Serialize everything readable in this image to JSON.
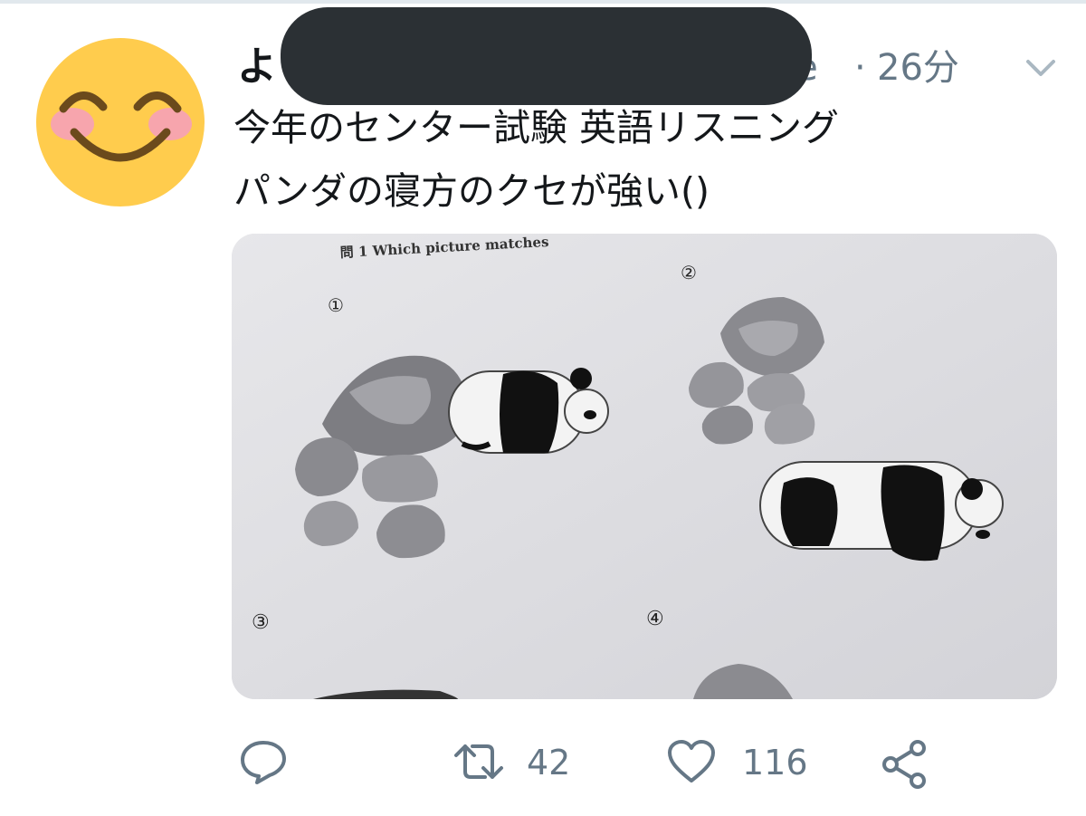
{
  "tweet": {
    "author_initial": "よ",
    "handle_tail": "le",
    "separator": "·",
    "time": "26分",
    "text": "今年のセンター試験 英語リスニング\nパンダの寝方のクセが強い()"
  },
  "media": {
    "header_text": "問 1  Which picture matches",
    "option_labels": [
      "①",
      "②",
      "③",
      "④"
    ]
  },
  "actions": {
    "reply_count": "",
    "retweet_count": "42",
    "like_count": "116"
  },
  "icons": {
    "avatar": "smiling-face-emoji",
    "menu": "chevron-down-icon",
    "reply": "reply-icon",
    "retweet": "retweet-icon",
    "like": "heart-icon",
    "share": "share-icon"
  },
  "colors": {
    "text": "#14171a",
    "secondary": "#657786",
    "redaction": "#2b3034"
  }
}
